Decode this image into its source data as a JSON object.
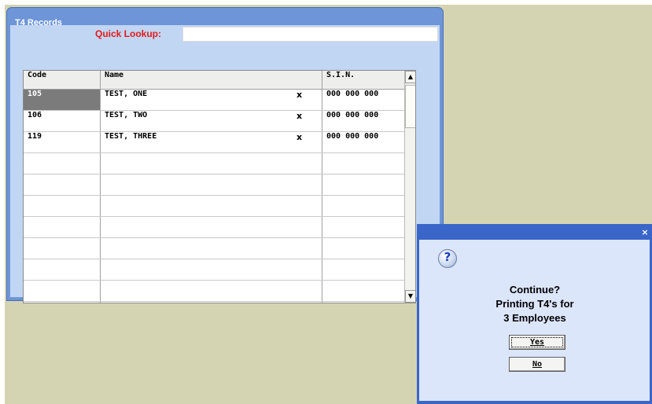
{
  "window": {
    "title": "T4 Records",
    "quick_lookup_label": "Quick Lookup:",
    "quick_lookup_value": ""
  },
  "grid": {
    "columns": [
      "Code",
      "Name",
      "S.I.N."
    ],
    "rows": [
      {
        "code": "105",
        "name": "TEST, ONE",
        "flag": "x",
        "sin": "000 000 000"
      },
      {
        "code": "106",
        "name": "TEST, TWO",
        "flag": "x",
        "sin": "000 000 000"
      },
      {
        "code": "119",
        "name": "TEST, THREE",
        "flag": "x",
        "sin": "000 000 000"
      }
    ],
    "selected_row": 0,
    "scroll_up_icon": "arrow-up-icon",
    "scroll_down_icon": "arrow-down-icon"
  },
  "dialog": {
    "close_icon": "close-icon",
    "icon": "question-icon",
    "line1": "Continue?",
    "line2": "Printing T4's for",
    "line3": "3 Employees",
    "yes_label": "Yes",
    "no_label": "No"
  }
}
